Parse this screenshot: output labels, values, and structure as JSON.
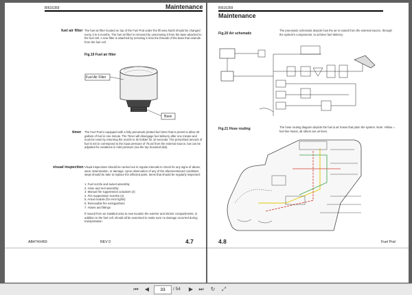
{
  "left_page": {
    "doc_number": "BI616359",
    "header_title": "Maintenance",
    "section_fuel_air_filter": {
      "heading": "fuel air filter",
      "text": "The fuel air filter located on top of the Fuel Pod under the fill area hatch should be changed every 3 to 6 months. The fuel air filter is removed by unscrewing it from the base attached to the fuel cell. A new filter is attached by screwing it onto the threads of the base that extends from the fuel cell."
    },
    "figure_19": {
      "caption": "Fig.19 Fuel air filter",
      "label_filter": "Fuel Air Filter",
      "label_base": "Base"
    },
    "section_timer": {
      "heading": "timer",
      "text": "The Fuel Pod is equipped with a fully pneumatic plotted fuel timer that is preset to allow 30 gallons of fuel in one minute. The Timer will disengage fuel delivery after one minute and must be reset by returning the nozzle to its holster for 10 seconds. The prescribed amount of fuel is set to correspond to the input pressure of 75 psi from the external source, but can be adjusted for variations in inlet pressure (via the top mounted dial)."
    },
    "section_visual": {
      "heading": "visual inspection",
      "text": "Visual inspections should be carried out in regular intervals to check for any signs of abuse, wear, deterioration, or damage. Upon observation of any of the aforementioned conditions steps should be take to replace the affected parts. Items that should be regularly inspected:",
      "items": [
        "1.   Fuel nozzle and swivel assembly",
        "2.   Hose and reel assembly",
        "3.   Manual fire suppression actuators (4)",
        "4.   Fire suppression nozzles (4)",
        "5.   Ansul module (for error lights)",
        "6.   Removable fire extinguishers",
        "7.   Hoses and fittings"
      ],
      "text2": "If moved from an installed area to new location the exterior and interior compartments, in addition to the fuel cell, should all be examined to make sure no damage occurred during transportation."
    },
    "footer_left": "AB474X450",
    "footer_mid": "REV 0",
    "page_num": "4.7"
  },
  "right_page": {
    "doc_number": "BI616359",
    "header_title": "Maintenance",
    "figure_20": {
      "caption": "Fig.20 Air schematic",
      "text": "The pneumatic schematic depicts how the air is routed from the external source, through the system's components, to achieve fuel delivery."
    },
    "figure_21": {
      "caption": "Fig.21 Hose routing",
      "text": "The hose routing diagram depicts the fuel & air hoses that plum the system. Note: Yellow = fuel line hoses, all others are air lines."
    },
    "page_num": "4.8",
    "footer_right": "Fuel Pod"
  },
  "toolbar": {
    "current_page": "33",
    "total_pages": "/ 54"
  },
  "colors": {
    "viewer_bg": "#5f5f5f",
    "toolbar_bg": "#e9e9e9",
    "fuel_line": "#e6d23a",
    "air_line_red": "#d33a2e",
    "air_line_green": "#39a043"
  }
}
